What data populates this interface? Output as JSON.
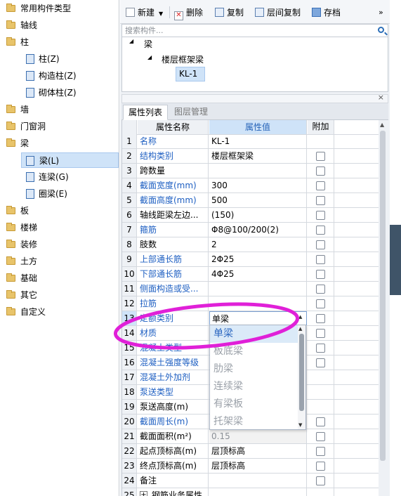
{
  "left_tree": {
    "items": [
      {
        "label": "常用构件类型",
        "kind": "folder"
      },
      {
        "label": "轴线",
        "kind": "folder"
      },
      {
        "label": "柱",
        "kind": "folder"
      },
      {
        "label": "柱(Z)",
        "kind": "child"
      },
      {
        "label": "构造柱(Z)",
        "kind": "child"
      },
      {
        "label": "砌体柱(Z)",
        "kind": "child"
      },
      {
        "label": "墙",
        "kind": "folder"
      },
      {
        "label": "门窗洞",
        "kind": "folder"
      },
      {
        "label": "梁",
        "kind": "folder"
      },
      {
        "label": "梁(L)",
        "kind": "child",
        "selected": true
      },
      {
        "label": "连梁(G)",
        "kind": "child"
      },
      {
        "label": "圈梁(E)",
        "kind": "child"
      },
      {
        "label": "板",
        "kind": "folder"
      },
      {
        "label": "楼梯",
        "kind": "folder"
      },
      {
        "label": "装修",
        "kind": "folder"
      },
      {
        "label": "土方",
        "kind": "folder"
      },
      {
        "label": "基础",
        "kind": "folder"
      },
      {
        "label": "其它",
        "kind": "folder"
      },
      {
        "label": "自定义",
        "kind": "folder"
      }
    ]
  },
  "toolbar": {
    "new_label": "新建",
    "delete_label": "删除",
    "copy_label": "复制",
    "floor_copy_label": "层间复制",
    "save_label": "存档",
    "more_label": "»"
  },
  "search": {
    "placeholder": "搜索构件..."
  },
  "component_tree": {
    "root": "梁",
    "child": "楼层框架梁",
    "leaf": "KL-1"
  },
  "tabs": {
    "properties": "属性列表",
    "layers": "图层管理"
  },
  "grid": {
    "headers": {
      "name": "属性名称",
      "value": "属性值",
      "extra": "附加"
    },
    "rows": [
      {
        "no": "1",
        "name": "名称",
        "value": "KL-1",
        "blue": true,
        "check": false
      },
      {
        "no": "2",
        "name": "结构类别",
        "value": "楼层框架梁",
        "blue": true,
        "check": true
      },
      {
        "no": "3",
        "name": "跨数量",
        "value": "",
        "blue": false,
        "check": true
      },
      {
        "no": "4",
        "name": "截面宽度(mm)",
        "value": "300",
        "blue": true,
        "check": true
      },
      {
        "no": "5",
        "name": "截面高度(mm)",
        "value": "500",
        "blue": true,
        "check": true
      },
      {
        "no": "6",
        "name": "轴线距梁左边...",
        "value": "(150)",
        "blue": false,
        "check": true
      },
      {
        "no": "7",
        "name": "箍筋",
        "value": "Φ8@100/200(2)",
        "blue": true,
        "check": true
      },
      {
        "no": "8",
        "name": "肢数",
        "value": "2",
        "blue": false,
        "check": true
      },
      {
        "no": "9",
        "name": "上部通长筋",
        "value": "2Φ25",
        "blue": true,
        "check": true
      },
      {
        "no": "10",
        "name": "下部通长筋",
        "value": "4Φ25",
        "blue": true,
        "check": true
      },
      {
        "no": "11",
        "name": "侧面构造或受...",
        "value": "",
        "blue": true,
        "check": true
      },
      {
        "no": "12",
        "name": "拉筋",
        "value": "",
        "blue": true,
        "check": true
      },
      {
        "no": "13",
        "name": "定额类别",
        "value": "单梁",
        "blue": true,
        "check": true
      },
      {
        "no": "14",
        "name": "材质",
        "value": "",
        "blue": true,
        "check": true
      },
      {
        "no": "15",
        "name": "混凝土类型",
        "value": "",
        "blue": true,
        "check": true
      },
      {
        "no": "16",
        "name": "混凝土强度等级",
        "value": "",
        "blue": true,
        "check": true
      },
      {
        "no": "17",
        "name": "混凝土外加剂",
        "value": "",
        "blue": true,
        "check": false
      },
      {
        "no": "18",
        "name": "泵送类型",
        "value": "",
        "blue": true,
        "check": false
      },
      {
        "no": "19",
        "name": "泵送高度(m)",
        "value": "",
        "blue": false,
        "check": false
      },
      {
        "no": "20",
        "name": "截面周长(m)",
        "value": "",
        "blue": true,
        "check": true
      },
      {
        "no": "21",
        "name": "截面面积(m²)",
        "value": "0.15",
        "blue": false,
        "check": true
      },
      {
        "no": "22",
        "name": "起点顶标高(m)",
        "value": "层顶标高",
        "blue": false,
        "check": true
      },
      {
        "no": "23",
        "name": "终点顶标高(m)",
        "value": "层顶标高",
        "blue": false,
        "check": true
      },
      {
        "no": "24",
        "name": "备注",
        "value": "",
        "blue": false,
        "check": true
      },
      {
        "no": "25",
        "name": "钢筋业务属性",
        "value": "",
        "blue": false,
        "check": false
      }
    ]
  },
  "dropdown": {
    "options": [
      "单梁",
      "板底梁",
      "肋梁",
      "连续梁",
      "有梁板",
      "托架梁"
    ],
    "selected": "单梁"
  },
  "colors": {
    "selection": "#cfe3f8",
    "link_blue": "#1e5fc2",
    "annotation": "#e020d8"
  }
}
